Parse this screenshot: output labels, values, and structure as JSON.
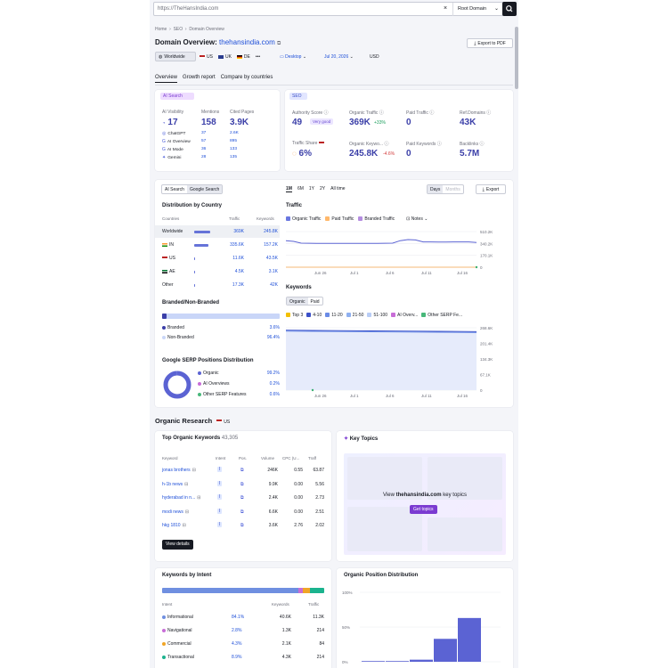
{
  "search": {
    "value": "https://TheHansIndia.com",
    "clear": "×",
    "scope": "Root Domain"
  },
  "breadcrumb": [
    "Home",
    "SEO",
    "Domain Overview"
  ],
  "header": {
    "title_prefix": "Domain Overview:",
    "domain": "thehansindia.com",
    "export": "Export to PDF"
  },
  "filters": {
    "worldwide": "Worldwide",
    "countries": [
      "US",
      "UK",
      "DE"
    ],
    "more": "•••",
    "device": "Desktop",
    "date": "Jul 20, 2026",
    "currency": "USD"
  },
  "tabs": [
    "Overview",
    "Growth report",
    "Compare by countries"
  ],
  "ai": {
    "badge": "AI Search",
    "visibility_label": "AI Visibility",
    "visibility": "17",
    "mentions_label": "Mentions",
    "mentions": "158",
    "cited_label": "Cited Pages",
    "cited": "3.9K",
    "engines": [
      {
        "name": "ChatGPT",
        "m": "37",
        "c": "2.6K"
      },
      {
        "name": "AI Overview",
        "m": "57",
        "c": "895"
      },
      {
        "name": "AI Mode",
        "m": "36",
        "c": "133"
      },
      {
        "name": "Gemini",
        "m": "28",
        "c": "135"
      }
    ]
  },
  "seo": {
    "badge": "SEO",
    "authority_label": "Authority Score",
    "authority": "49",
    "authority_badge": "Very good",
    "organic_label": "Organic Traffic",
    "organic": "369K",
    "organic_delta": "+33%",
    "paid_label": "Paid Traffic",
    "paid": "0",
    "ref_label": "Ref.Domains",
    "ref": "43K",
    "share_label": "Traffic Share",
    "share": "6%",
    "okw_label": "Organic Keywo...",
    "okw": "245.8K",
    "okw_delta": "-4.6%",
    "pkw_label": "Paid Keywords",
    "pkw": "0",
    "backlinks_label": "Backlinks",
    "backlinks": "5.7M"
  },
  "dist": {
    "seg": [
      "AI Search",
      "Google Search"
    ],
    "title": "Distribution by Country",
    "cols": [
      "Countries",
      "Traffic",
      "Keywords"
    ],
    "rows": [
      {
        "name": "Worldwide",
        "share": 1.0,
        "t": "369K",
        "k": "245.8K"
      },
      {
        "name": "IN",
        "share": 0.91,
        "t": "335.6K",
        "k": "157.2K"
      },
      {
        "name": "US",
        "share": 0.03,
        "t": "11.6K",
        "k": "43.5K"
      },
      {
        "name": "AE",
        "share": 0.01,
        "t": "4.5K",
        "k": "3.1K"
      },
      {
        "name": "Other",
        "share": 0.05,
        "t": "17.3K",
        "k": "42K"
      }
    ]
  },
  "branded": {
    "title": "Branded/Non-Branded",
    "branded_share": 0.036,
    "items": [
      {
        "label": "Branded",
        "v": "3.6%"
      },
      {
        "label": "Non-Branded",
        "v": "96.4%"
      }
    ]
  },
  "serp": {
    "title": "Google SERP Positions Distribution",
    "organic_share": 0.992,
    "items": [
      {
        "label": "Organic",
        "v": "99.2%",
        "c": "#5b63d3"
      },
      {
        "label": "AI Overviews",
        "v": "0.2%",
        "c": "#c86dd7"
      },
      {
        "label": "Other SERP Features",
        "v": "0.6%",
        "c": "#48b87a"
      }
    ]
  },
  "traffic": {
    "ranges": [
      "1M",
      "6M",
      "1Y",
      "2Y",
      "All time"
    ],
    "days": "Days",
    "months": "Months",
    "export": "Export",
    "title": "Traffic",
    "legend": [
      "Organic Traffic",
      "Paid Traffic",
      "Branded Traffic"
    ],
    "notes": "Notes",
    "y_ticks": [
      "510.2K",
      "340.2K",
      "170.1K",
      "0"
    ],
    "x_ticks": [
      "Jun 26",
      "Jul 1",
      "Jul 6",
      "Jul 11",
      "Jul 16"
    ]
  },
  "traffic_chart": {
    "type": "line",
    "x": [
      "Jun 24",
      "Jun 25",
      "Jun 26",
      "Jun 27",
      "Jun 28",
      "Jun 29",
      "Jun 30",
      "Jul 1",
      "Jul 2",
      "Jul 3",
      "Jul 4",
      "Jul 5",
      "Jul 6",
      "Jul 7",
      "Jul 8",
      "Jul 9",
      "Jul 10",
      "Jul 11",
      "Jul 12",
      "Jul 13",
      "Jul 14",
      "Jul 15",
      "Jul 16",
      "Jul 17",
      "Jul 18",
      "Jul 19"
    ],
    "series": [
      {
        "name": "Organic Traffic",
        "values": [
          380,
          370,
          345,
          343,
          342,
          341,
          342,
          341,
          340,
          340,
          341,
          342,
          342,
          343,
          345,
          380,
          395,
          390,
          362,
          362,
          360,
          361,
          362,
          362,
          362,
          355
        ]
      },
      {
        "name": "Paid Traffic",
        "values": [
          0,
          0,
          0,
          0,
          0,
          0,
          0,
          0,
          0,
          0,
          0,
          0,
          0,
          0,
          0,
          0,
          0,
          0,
          0,
          0,
          0,
          0,
          0,
          0,
          0,
          0
        ]
      }
    ],
    "ylim": [
      0,
      510.2
    ]
  },
  "keywords": {
    "title": "Keywords",
    "tabs": [
      "Organic",
      "Paid"
    ],
    "legend": [
      "Top 3",
      "4-10",
      "11-20",
      "21-50",
      "51-100",
      "AI Overv...",
      "Other SERP Fe..."
    ],
    "y_ticks": [
      "268.6K",
      "201.4K",
      "134.3K",
      "67.1K",
      "0"
    ],
    "x_ticks": [
      "Jun 26",
      "Jul 1",
      "Jul 6",
      "Jul 11",
      "Jul 16"
    ]
  },
  "keywords_chart": {
    "type": "area",
    "x": [
      "Jun 24",
      "Jul 19"
    ],
    "series": [
      {
        "name": "Top 3",
        "values": [
          258,
          252
        ]
      },
      {
        "name": "4-10",
        "values": [
          254,
          248
        ]
      }
    ],
    "ylim": [
      0,
      268.6
    ]
  },
  "research": {
    "title": "Organic Research",
    "country": "US"
  },
  "top_kw": {
    "title": "Top Organic Keywords",
    "count": "43,305",
    "cols": [
      "Keyword",
      "Intent",
      "Pos.",
      "Volume",
      "CPC (U...",
      "Traff"
    ],
    "rows": [
      {
        "k": "jonas brothers",
        "i": "I",
        "v": "246K",
        "c": "0.55",
        "t": "63.87"
      },
      {
        "k": "h-1b news",
        "i": "I",
        "v": "9.9K",
        "c": "0.00",
        "t": "5.56"
      },
      {
        "k": "hyderabad in n...",
        "i": "I",
        "v": "2.4K",
        "c": "0.00",
        "t": "2.73"
      },
      {
        "k": "modi news",
        "i": "I",
        "v": "6.6K",
        "c": "0.00",
        "t": "2.51"
      },
      {
        "k": "hkg 1810",
        "i": "I",
        "v": "3.6K",
        "c": "2.76",
        "t": "2.02"
      }
    ],
    "details": "View details"
  },
  "topics": {
    "title": "Key Topics",
    "view": "View",
    "domain": "thehansindia.com",
    "suffix": "key topics",
    "button": "Get topics"
  },
  "intent": {
    "title": "Keywords by Intent",
    "cols": [
      "Intent",
      "Keywords",
      "Traffic"
    ],
    "rows": [
      {
        "name": "Informational",
        "pct": "84.1%",
        "k": "40.6K",
        "t": "11.3K",
        "c": "#6f8fe0"
      },
      {
        "name": "Navigational",
        "pct": "2.8%",
        "k": "1.3K",
        "t": "214",
        "c": "#c86dd7"
      },
      {
        "name": "Commercial",
        "pct": "4.3%",
        "k": "2.1K",
        "t": "84",
        "c": "#f0a526"
      },
      {
        "name": "Transactional",
        "pct": "8.9%",
        "k": "4.3K",
        "t": "214",
        "c": "#1bb38e"
      }
    ]
  },
  "position": {
    "title": "Organic Position Distribution",
    "y_ticks": [
      "100%",
      "50%",
      "0%"
    ]
  },
  "position_chart": {
    "type": "bar",
    "values": [
      1,
      1,
      3,
      33,
      63
    ],
    "ylim": [
      0,
      100
    ]
  }
}
